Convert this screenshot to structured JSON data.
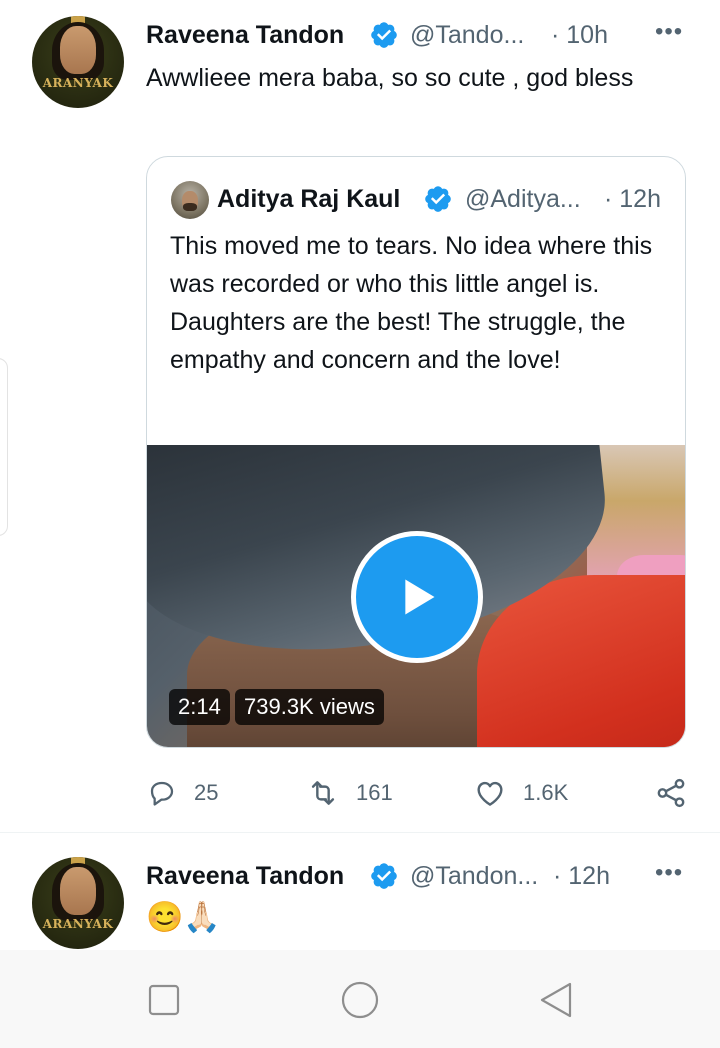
{
  "tweet1": {
    "name": "Raveena Tandon",
    "handle": "@Tando...",
    "time": "· 10h",
    "text": "Awwlieee mera baba, so so cute , god bless",
    "avatar_text": "ARANYAK"
  },
  "quoted": {
    "name": "Aditya Raj Kaul",
    "handle": "@Aditya...",
    "time": "· 12h",
    "text": "This moved me to tears. No idea where this was recorded or who this little angel is. Daughters are the best! The struggle, the empathy and concern and the love!",
    "video": {
      "duration": "2:14",
      "views": "739.3K views"
    }
  },
  "actions": {
    "replies": "25",
    "retweets": "161",
    "likes": "1.6K"
  },
  "tweet2": {
    "name": "Raveena Tandon",
    "handle": "@Tandon...",
    "time": "· 12h",
    "emoji_1": "😊",
    "emoji_2": "🙏🏻",
    "avatar_text": "ARANYAK"
  },
  "more_glyph": "•••",
  "colors": {
    "accent": "#1d9bf0",
    "text": "#0f1419",
    "secondary": "#536471",
    "border": "#cfd9de"
  },
  "icons": [
    "verified-badge-icon",
    "more-icon",
    "play-icon",
    "reply-icon",
    "retweet-icon",
    "like-icon",
    "share-icon",
    "nav-recents-icon",
    "nav-home-icon",
    "nav-back-icon"
  ]
}
